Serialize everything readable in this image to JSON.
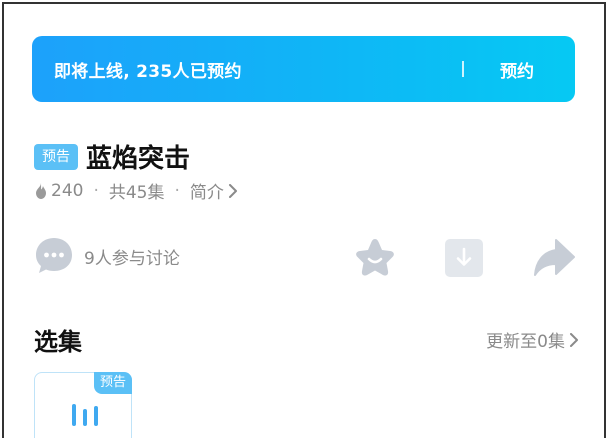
{
  "banner": {
    "text": "即将上线, 235人已预约",
    "button_label": "预约",
    "gradient_start": "#1da1fb",
    "gradient_end": "#06c9f3"
  },
  "show": {
    "tag": "预告",
    "title": "蓝焰突击",
    "heat": "240",
    "episodes": "共45集",
    "intro": "简介"
  },
  "actions": {
    "discuss_label": "9人参与讨论",
    "icons": [
      "chat-bubble-icon",
      "star-icon",
      "download-icon",
      "share-icon"
    ]
  },
  "episodes_section": {
    "title": "选集",
    "update_label": "更新至0集",
    "card": {
      "tag": "预告",
      "icon": "playing-bars-icon"
    }
  },
  "colors": {
    "accent": "#5bc0f6",
    "icon_gray": "#c7cdd6",
    "muted_text": "#8a8a8a"
  }
}
